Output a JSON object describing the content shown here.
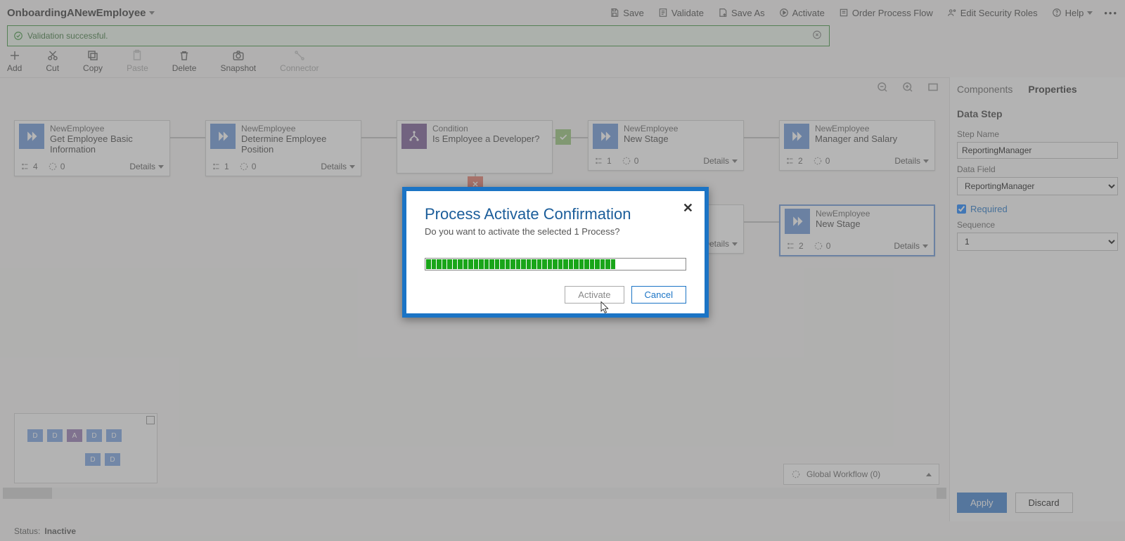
{
  "topbar": {
    "process_name": "OnboardingANewEmployee",
    "commands": {
      "save": "Save",
      "validate": "Validate",
      "save_as": "Save As",
      "activate": "Activate",
      "order": "Order Process Flow",
      "security": "Edit Security Roles",
      "help": "Help"
    }
  },
  "validation": {
    "message": "Validation successful."
  },
  "ribbon": {
    "add": "Add",
    "cut": "Cut",
    "copy": "Copy",
    "paste": "Paste",
    "delete": "Delete",
    "snapshot": "Snapshot",
    "connector": "Connector"
  },
  "stages": [
    {
      "id": "s1",
      "entity": "NewEmployee",
      "title": "Get Employee Basic Information",
      "stats": {
        "steps": "4",
        "flows": "0"
      },
      "details": "Details"
    },
    {
      "id": "s2",
      "entity": "NewEmployee",
      "title": "Determine Employee Position",
      "stats": {
        "steps": "1",
        "flows": "0"
      },
      "details": "Details"
    },
    {
      "id": "s3",
      "entity": "Condition",
      "title": "Is Employee a Developer?",
      "details": "",
      "kind": "condition"
    },
    {
      "id": "s4",
      "entity": "NewEmployee",
      "title": "New Stage",
      "stats": {
        "steps": "1",
        "flows": "0"
      },
      "details": "Details"
    },
    {
      "id": "s5",
      "entity": "NewEmployee",
      "title": "Manager and Salary",
      "stats": {
        "steps": "2",
        "flows": "0"
      },
      "details": "Details"
    },
    {
      "id": "s6",
      "entity": "",
      "title": "",
      "details": "Details",
      "hidden": true
    },
    {
      "id": "s7",
      "entity": "NewEmployee",
      "title": "New Stage",
      "stats": {
        "steps": "2",
        "flows": "0"
      },
      "details": "Details",
      "selected": true
    }
  ],
  "globalWorkflow": "Global Workflow (0)",
  "status": {
    "label": "Status:",
    "value": "Inactive"
  },
  "props": {
    "tabs": {
      "components": "Components",
      "properties": "Properties"
    },
    "section_title": "Data Step",
    "step_name_label": "Step Name",
    "step_name_value": "ReportingManager",
    "data_field_label": "Data Field",
    "data_field_value": "ReportingManager",
    "required_label": "Required",
    "sequence_label": "Sequence",
    "sequence_value": "1",
    "apply": "Apply",
    "discard": "Discard"
  },
  "modal": {
    "title": "Process Activate Confirmation",
    "subtitle": "Do you want to activate the selected 1 Process?",
    "activate": "Activate",
    "cancel": "Cancel"
  }
}
